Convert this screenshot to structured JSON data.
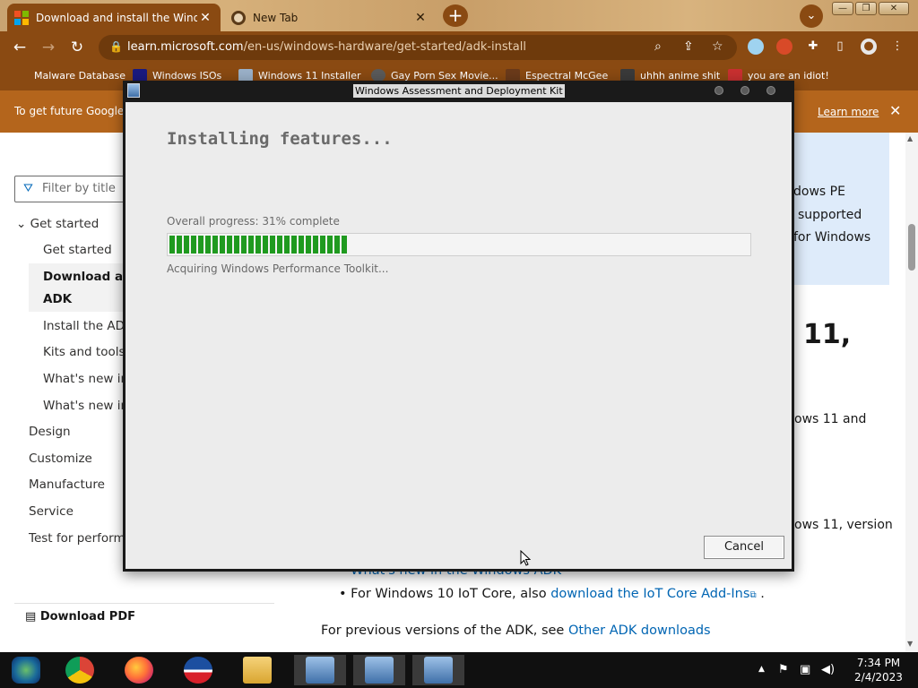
{
  "browser": {
    "tabs": [
      {
        "title": "Download and install the Windows",
        "close": "✕"
      },
      {
        "title": "New Tab",
        "close": "✕"
      }
    ],
    "new_tab_label": "+",
    "profile_chevron": "⌄",
    "window_controls": [
      "—",
      "❐",
      "✕"
    ],
    "nav": {
      "back": "←",
      "forward": "→",
      "reload": "↻"
    },
    "url_host": "learn.microsoft.com",
    "url_path": "/en-us/windows-hardware/get-started/adk-install",
    "bookmarks": [
      "Malware Database",
      "Windows ISOs",
      "Windows 11 Installer",
      "Gay Porn Sex Movie...",
      "Espectral McGee",
      "uhhh anime shit",
      "you are an idiot!"
    ],
    "infobar": {
      "message": "To get future Google",
      "learn_more": "Learn more",
      "close": "✕"
    },
    "colors": {
      "frame": "#8a4a12",
      "infobar": "#b4651c",
      "progress_green": "#1f9a1f"
    }
  },
  "page": {
    "filter_placeholder": "Filter by title",
    "toc": {
      "get_started_group": "Get started",
      "items": [
        "Get started",
        "Download an",
        "ADK",
        "Install the ADK",
        "Kits and tools o",
        "What's new in",
        "What's new in"
      ],
      "sections": [
        "Design",
        "Customize",
        "Manufacture",
        "Service",
        "Test for performa"
      ]
    },
    "download_pdf": "Download PDF",
    "right_fragments": {
      "note_line1": "dows PE",
      "note_line2": "supported",
      "note_line3": "for Windows",
      "heading_fragment": "11,",
      "line_a": "ows 11 and",
      "line_b": "ows 11, version"
    },
    "bullet_faded": "What's new in the Windows ADK",
    "bullet_iot_prefix": "For Windows 10 IoT Core, also",
    "bullet_iot_link": "download the IoT Core Add-Ins",
    "bullet_iot_suffix": ".",
    "prev_versions_prefix": "For previous versions of the ADK, see",
    "prev_versions_link": "Other ADK downloads"
  },
  "dialog": {
    "title": "Windows Assessment and Deployment Kit",
    "heading": "Installing features...",
    "progress_label": "Overall progress: 31% complete",
    "progress_fraction": 0.31,
    "status": "Acquiring Windows Performance Toolkit...",
    "cancel": "Cancel"
  },
  "taskbar": {
    "apps": [
      "windows-media-center",
      "chrome",
      "firefox",
      "obama-icon",
      "file-explorer",
      "adk-setup",
      "adk-setup",
      "adk-setup"
    ],
    "time": "7:34 PM",
    "date": "2/4/2023",
    "tray_chevron": "▲"
  }
}
